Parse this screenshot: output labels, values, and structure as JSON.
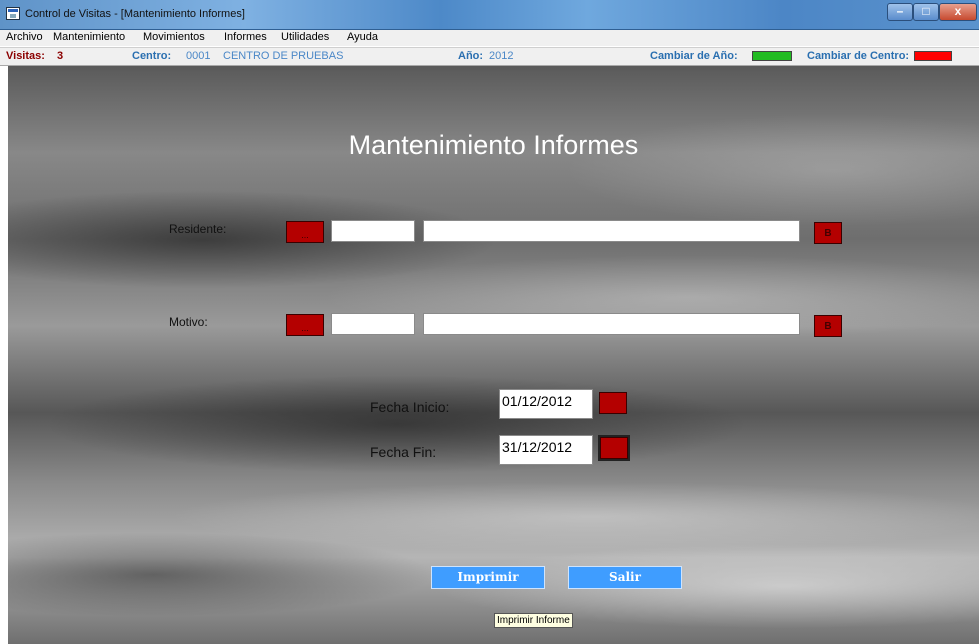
{
  "window": {
    "title": "Control de Visitas - [Mantenimiento Informes]",
    "minimize": "–",
    "maximize": "□",
    "close": "x"
  },
  "menu": [
    "Archivo",
    "Mantenimiento",
    "Movimientos",
    "Informes",
    "Utilidades",
    "Ayuda"
  ],
  "status": {
    "visitas_label": "Visitas:",
    "visitas_value": "3",
    "centro_label": "Centro:",
    "centro_code": "0001",
    "centro_name": "CENTRO DE PRUEBAS",
    "anio_label": "Año:",
    "anio_value": "2012",
    "cambiar_anio_label": "Cambiar de Año:",
    "cambiar_anio_color": "#22bb22",
    "cambiar_centro_label": "Cambiar de Centro:",
    "cambiar_centro_color": "#ff0000"
  },
  "form": {
    "title": "Mantenimiento Informes",
    "residente_label": "Residente:",
    "residente_code": "",
    "residente_name": "",
    "motivo_label": "Motivo:",
    "motivo_code": "",
    "motivo_name": "",
    "lookup_dots": "...",
    "search_label": "B",
    "fecha_inicio_label": "Fecha Inicio:",
    "fecha_inicio_value": "01/12/2012",
    "fecha_fin_label": "Fecha Fin:",
    "fecha_fin_value": "31/12/2012",
    "imprimir_label": "Imprimir",
    "salir_label": "Salir",
    "tooltip": "Imprimir Informe"
  },
  "colors": {
    "accent_red": "#b40000",
    "button_blue": "#3f9dff"
  }
}
